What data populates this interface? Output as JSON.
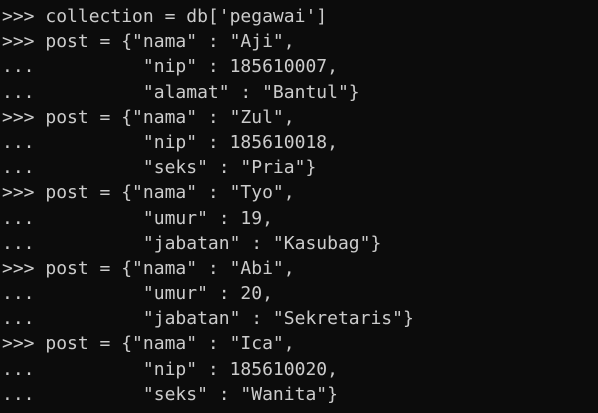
{
  "console": {
    "lines": [
      {
        "prompt": ">>> ",
        "code": "collection = db['pegawai']"
      },
      {
        "prompt": ">>> ",
        "code": "post = {\"nama\" : \"Aji\","
      },
      {
        "prompt": "... ",
        "code": "         \"nip\" : 185610007,"
      },
      {
        "prompt": "... ",
        "code": "         \"alamat\" : \"Bantul\"}"
      },
      {
        "prompt": ">>> ",
        "code": "post = {\"nama\" : \"Zul\","
      },
      {
        "prompt": "... ",
        "code": "         \"nip\" : 185610018,"
      },
      {
        "prompt": "... ",
        "code": "         \"seks\" : \"Pria\"}"
      },
      {
        "prompt": ">>> ",
        "code": "post = {\"nama\" : \"Tyo\","
      },
      {
        "prompt": "... ",
        "code": "         \"umur\" : 19,"
      },
      {
        "prompt": "... ",
        "code": "         \"jabatan\" : \"Kasubag\"}"
      },
      {
        "prompt": ">>> ",
        "code": "post = {\"nama\" : \"Abi\","
      },
      {
        "prompt": "... ",
        "code": "         \"umur\" : 20,"
      },
      {
        "prompt": "... ",
        "code": "         \"jabatan\" : \"Sekretaris\"}"
      },
      {
        "prompt": ">>> ",
        "code": "post = {\"nama\" : \"Ica\","
      },
      {
        "prompt": "... ",
        "code": "         \"nip\" : 185610020,"
      },
      {
        "prompt": "... ",
        "code": "         \"seks\" : \"Wanita\"}"
      }
    ]
  }
}
